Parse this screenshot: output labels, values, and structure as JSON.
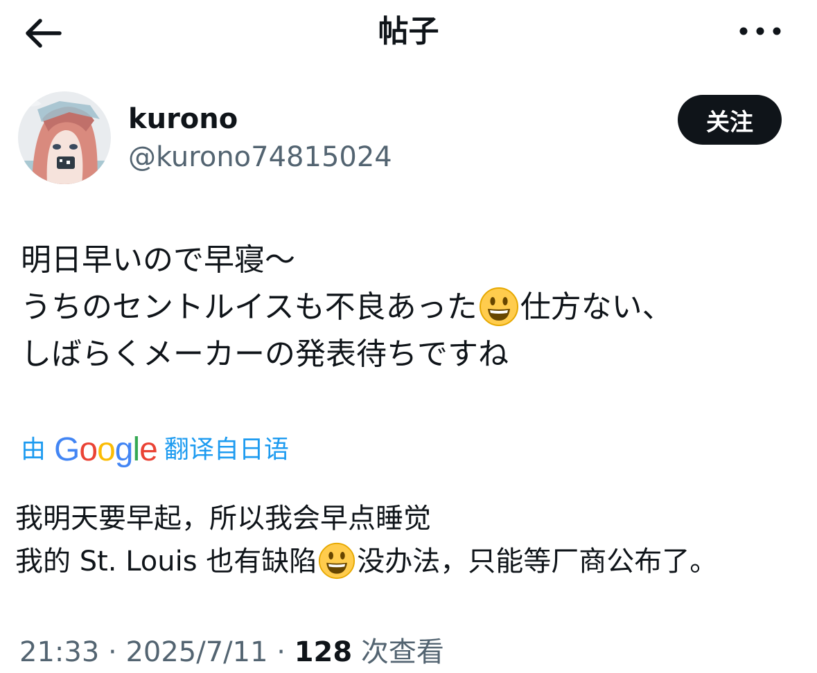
{
  "header": {
    "title": "帖子",
    "back_icon": "arrow-left-icon",
    "more_icon": "more-horizontal-icon"
  },
  "author": {
    "name": "kurono",
    "handle": "@kurono74815024",
    "follow_label": "关注",
    "avatar_icon": "anime-girl-avatar"
  },
  "post": {
    "line1": "明日早いので早寝～",
    "line2_before": "うちのセントルイスも不良あった",
    "line2_after": "仕方ない、",
    "line3": "しばらくメーカーの発表待ちですね",
    "emoji_icon": "smiley-face-emoji"
  },
  "translation": {
    "prefix": "由",
    "google_letters": [
      "G",
      "o",
      "o",
      "g",
      "l",
      "e"
    ],
    "google_colors": [
      "#4285F4",
      "#EA4335",
      "#FBBC05",
      "#4285F4",
      "#34A853",
      "#EA4335"
    ],
    "suffix": "翻译自日语",
    "line1": "我明天要早起，所以我会早点睡觉",
    "line2_before": "我的 St. Louis 也有缺陷",
    "line2_after": "没办法，只能等厂商公布了。"
  },
  "meta": {
    "time": "21:33",
    "separator": "·",
    "date": "2025/7/11",
    "views_count": "128",
    "views_label": "次查看"
  },
  "colors": {
    "accent": "#1d9bf0",
    "text": "#0f1419",
    "secondary": "#536471",
    "emoji": "#FFCC4D"
  }
}
